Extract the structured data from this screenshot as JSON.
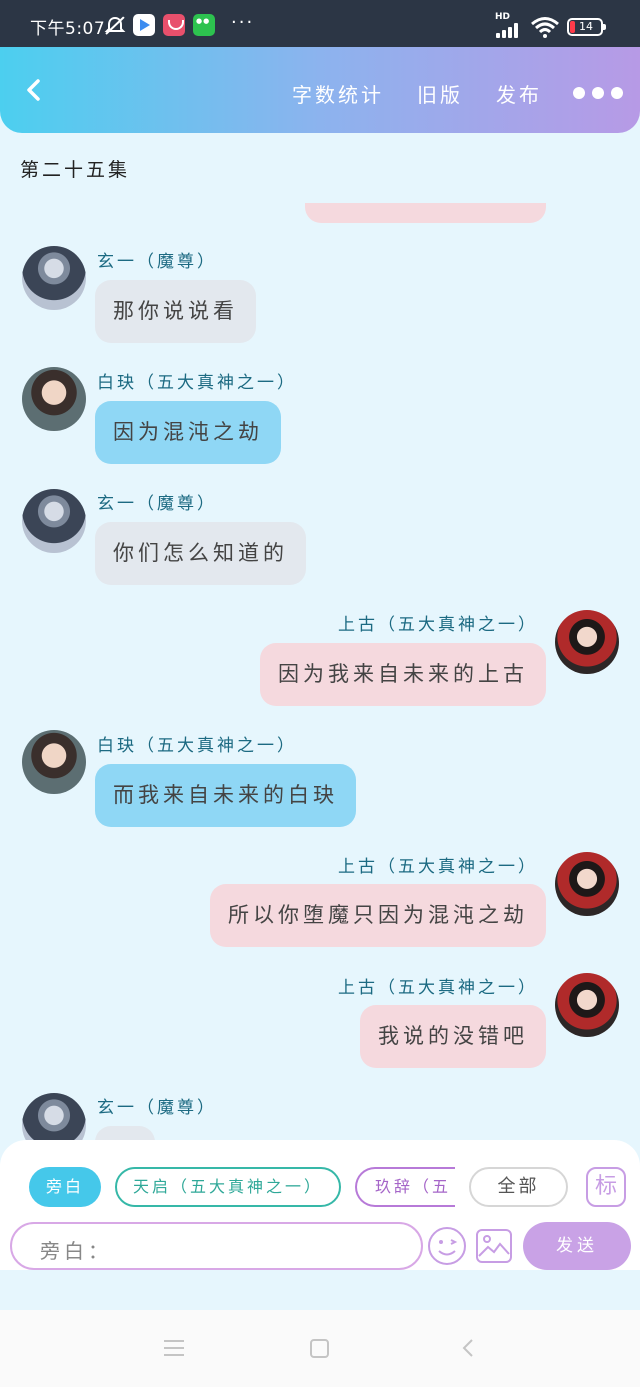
{
  "status_bar": {
    "time": "下午5:07",
    "more": "···",
    "network": "HD",
    "battery": "14"
  },
  "header": {
    "word_count": "字数统计",
    "old_version": "旧版",
    "publish": "发布"
  },
  "chat": {
    "episode_title": "第二十五集",
    "messages": [
      {
        "speaker": "玄一（魔尊）",
        "text": "那你说说看"
      },
      {
        "speaker": "白玦（五大真神之一）",
        "text": "因为混沌之劫"
      },
      {
        "speaker": "玄一（魔尊）",
        "text": "你们怎么知道的"
      },
      {
        "speaker": "上古（五大真神之一）",
        "text": "因为我来自未来的上古"
      },
      {
        "speaker": "白玦（五大真神之一）",
        "text": "而我来自未来的白玦"
      },
      {
        "speaker": "上古（五大真神之一）",
        "text": "所以你堕魔只因为混沌之劫"
      },
      {
        "speaker": "上古（五大真神之一）",
        "text": "我说的没错吧"
      },
      {
        "speaker": "玄一（魔尊）",
        "text": ""
      }
    ]
  },
  "input_panel": {
    "roles": [
      "旁白",
      "天启（五大真神之一）",
      "玖辞（五"
    ],
    "all_label": "全部",
    "tag_label": "标",
    "input_prefix": "旁白：",
    "send_label": "发送"
  },
  "colors": {
    "header_gradient_start": "#4ccfef",
    "header_gradient_end": "#b79ae6",
    "bubble_left_grey": "#e3e8ee",
    "bubble_left_blue": "#8fd7f5",
    "bubble_right_pink": "#f5d9de",
    "chat_background": "#e6f6fd"
  }
}
